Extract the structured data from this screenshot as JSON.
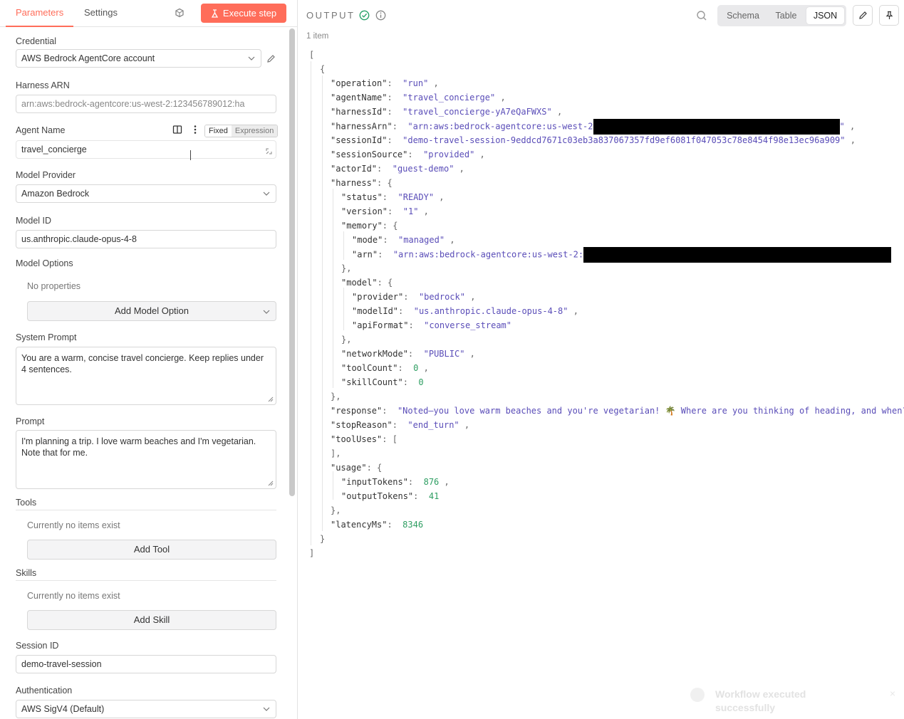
{
  "tabs": {
    "parameters": "Parameters",
    "settings": "Settings"
  },
  "execute_label": "Execute step",
  "form": {
    "credential": {
      "label": "Credential",
      "value": "AWS Bedrock AgentCore account"
    },
    "harness_arn": {
      "label": "Harness ARN",
      "value": "arn:aws:bedrock-agentcore:us-west-2:123456789012:ha"
    },
    "agent_name": {
      "label": "Agent Name",
      "value": "travel_concierge",
      "mode_fixed": "Fixed",
      "mode_expression": "Expression"
    },
    "model_provider": {
      "label": "Model Provider",
      "value": "Amazon Bedrock"
    },
    "model_id": {
      "label": "Model ID",
      "value": "us.anthropic.claude-opus-4-8"
    },
    "model_options": {
      "label": "Model Options",
      "empty": "No properties",
      "add_label": "Add Model Option"
    },
    "system_prompt": {
      "label": "System Prompt",
      "value": "You are a warm, concise travel concierge. Keep replies under 4 sentences."
    },
    "prompt": {
      "label": "Prompt",
      "value": "I'm planning a trip. I love warm beaches and I'm vegetarian. Note that for me."
    },
    "tools": {
      "label": "Tools",
      "empty": "Currently no items exist",
      "add_label": "Add Tool"
    },
    "skills": {
      "label": "Skills",
      "empty": "Currently no items exist",
      "add_label": "Add Skill"
    },
    "session_id": {
      "label": "Session ID",
      "value": "demo-travel-session"
    },
    "authentication": {
      "label": "Authentication",
      "value": "AWS SigV4 (Default)"
    }
  },
  "output": {
    "title": "OUTPUT",
    "items_count": "1 item",
    "views": {
      "schema": "Schema",
      "table": "Table",
      "json": "JSON"
    },
    "json": {
      "operation": "run",
      "agentName": "travel_concierge",
      "harnessId": "travel_concierge-yA7eQaFWXS",
      "harnessArn_prefix": "arn:aws:bedrock-agentcore:us-west-2",
      "sessionId": "demo-travel-session-9eddcd7671c03eb3a837067357fd9ef6081f047053c78e8454f98e13ec96a909",
      "sessionSource": "provided",
      "actorId": "guest-demo",
      "harness_status": "READY",
      "harness_version": "1",
      "memory_mode": "managed",
      "memory_arn_prefix": "arn:aws:bedrock-agentcore:us-west-2:",
      "model_provider": "bedrock",
      "model_modelId": "us.anthropic.claude-opus-4-8",
      "model_apiFormat": "converse_stream",
      "networkMode": "PUBLIC",
      "toolCount": "0",
      "skillCount": "0",
      "response": "Noted—you love warm beaches and you're vegetarian! 🌴 Where are you thinking of heading, and when?",
      "stopReason": "end_turn",
      "inputTokens": "876",
      "outputTokens": "41",
      "latencyMs": "8346"
    }
  },
  "toast": {
    "message": "Workflow executed successfully",
    "close": "×"
  },
  "colors": {
    "accent": "#ff6d5a",
    "string": "#5a4db8",
    "number": "#2e9e62",
    "success": "#29a36a"
  },
  "icons": [
    "docs-icon",
    "play-icon",
    "chevron-down-icon",
    "pencil-icon",
    "panel-icon",
    "more-vertical-icon",
    "expand-icon",
    "check-circle-icon",
    "info-icon",
    "search-icon",
    "pin-icon",
    "resize-handle-icon"
  ]
}
